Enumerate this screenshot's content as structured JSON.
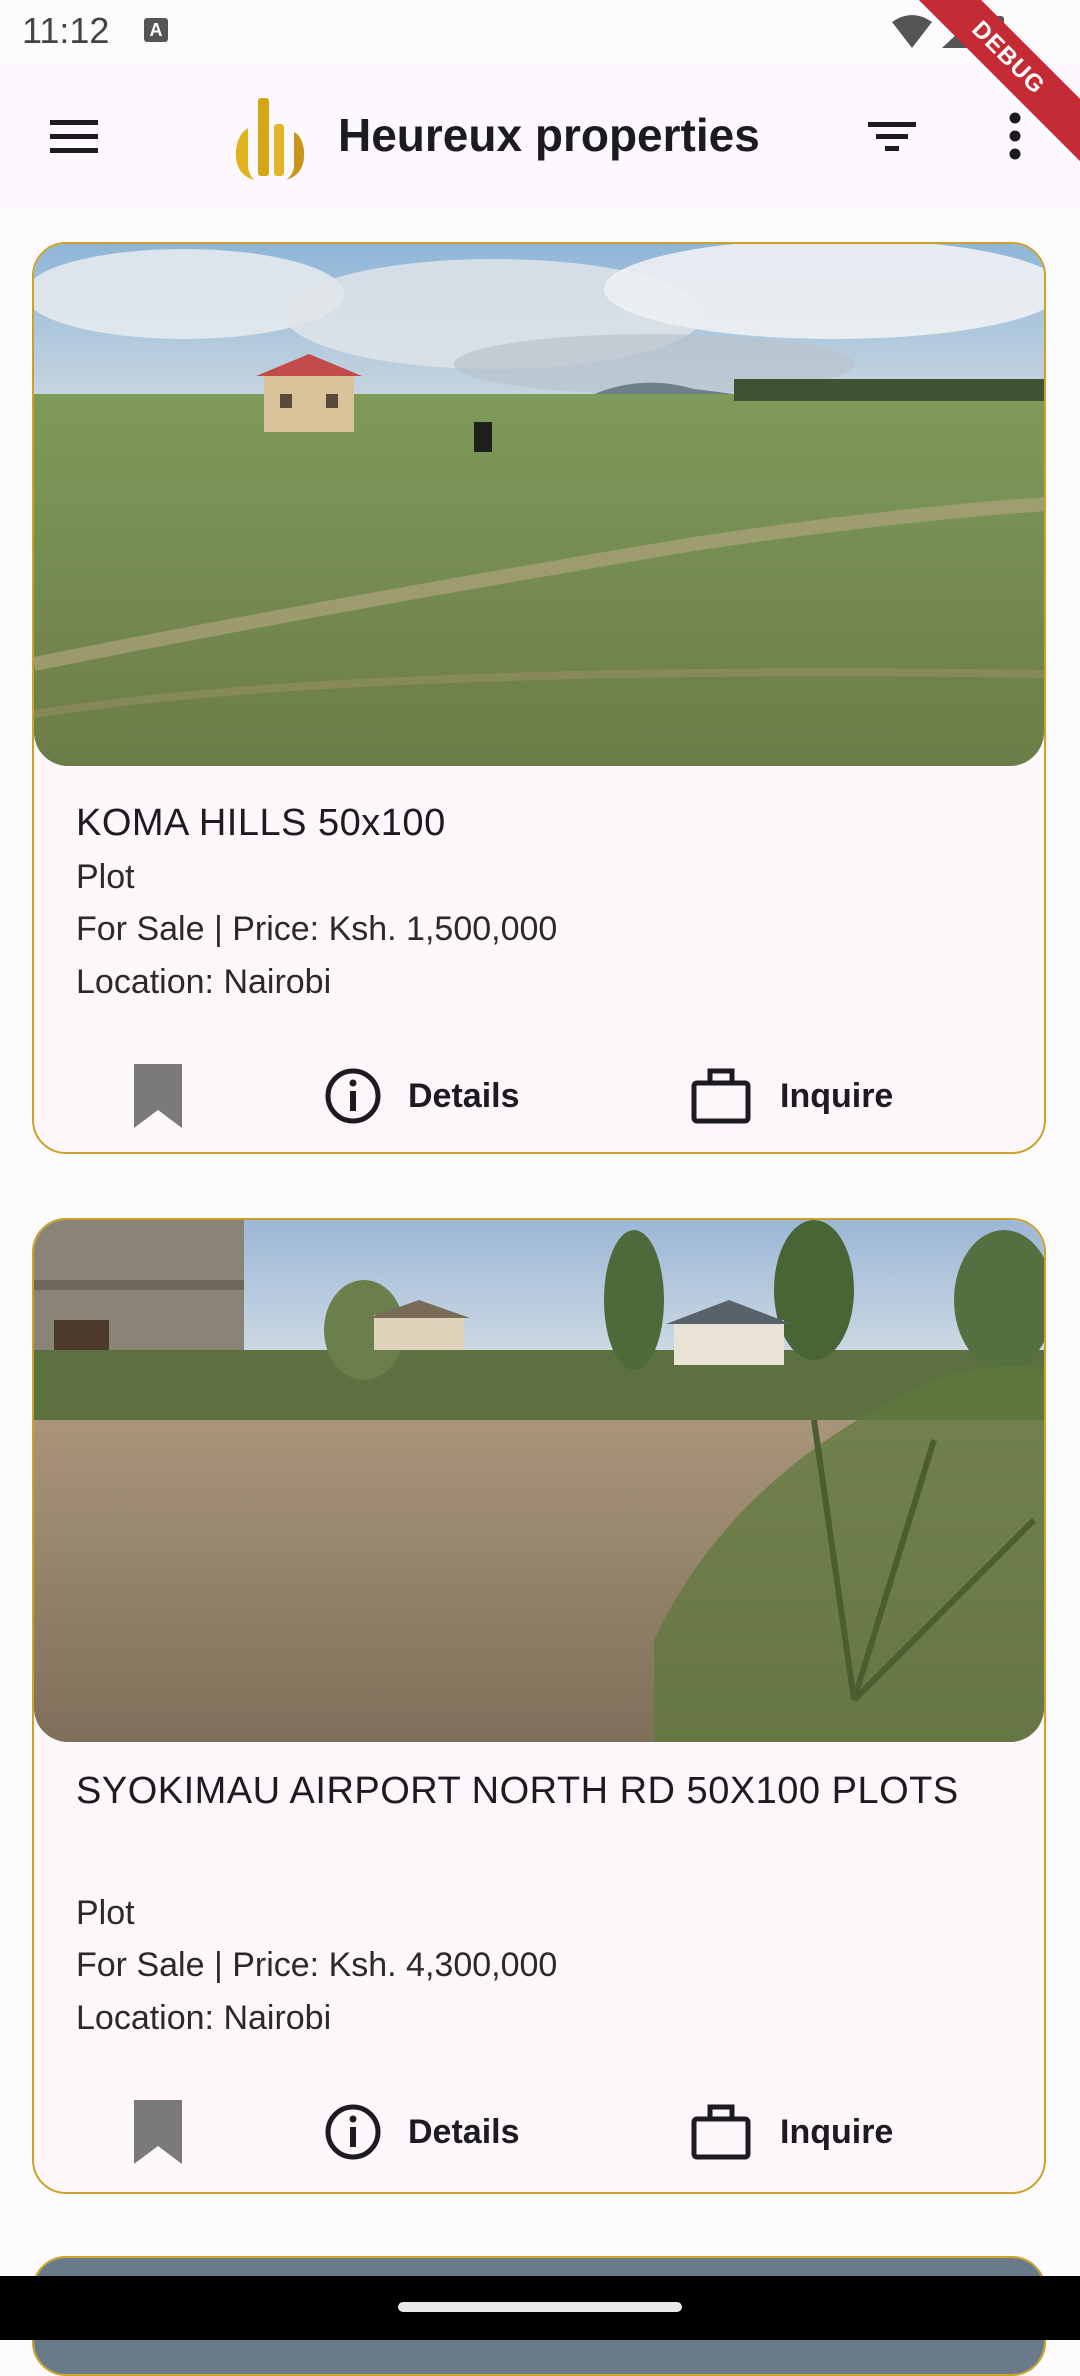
{
  "status_bar": {
    "time": "11:12",
    "keyboard_badge": "A"
  },
  "debug_banner": "DEBUG",
  "app_bar": {
    "title": "Heureux properties",
    "menu_icon": "hamburger-menu-icon",
    "filter_icon": "filter-icon",
    "more_icon": "more-vert-icon",
    "brand_color": "#c9a227"
  },
  "listings": [
    {
      "title": "KOMA HILLS 50x100",
      "type": "Plot",
      "sale_price": "For Sale | Price: Ksh. 1,500,000",
      "location": "Location: Nairobi",
      "bookmark_icon": "bookmark-icon",
      "details_label": "Details",
      "inquire_label": "Inquire"
    },
    {
      "title": "SYOKIMAU AIRPORT NORTH RD 50X100 PLOTS",
      "type": "Plot",
      "sale_price": "For Sale | Price: Ksh. 4,300,000",
      "location": "Location: Nairobi",
      "bookmark_icon": "bookmark-icon",
      "details_label": "Details",
      "inquire_label": "Inquire"
    }
  ]
}
